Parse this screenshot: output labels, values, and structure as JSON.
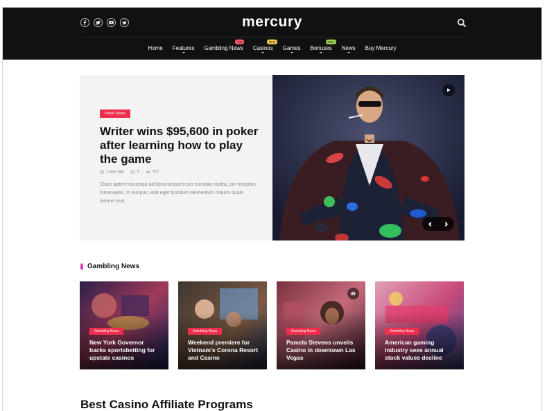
{
  "header": {
    "logo": "mercury",
    "social_icons": [
      "facebook-icon",
      "twitter-icon",
      "youtube-icon",
      "reddit-icon"
    ],
    "search_icon": "search-icon"
  },
  "nav": {
    "items": [
      {
        "label": "Home",
        "caret": false,
        "badge": ""
      },
      {
        "label": "Features",
        "caret": true,
        "badge": ""
      },
      {
        "label": "Gambling News",
        "caret": false,
        "badge": "Hot"
      },
      {
        "label": "Casinos",
        "caret": true,
        "badge": "Deal"
      },
      {
        "label": "Games",
        "caret": true,
        "badge": ""
      },
      {
        "label": "Bonuses",
        "caret": true,
        "badge": "New"
      },
      {
        "label": "News",
        "caret": true,
        "badge": ""
      },
      {
        "label": "Buy Mercury",
        "caret": false,
        "badge": ""
      }
    ]
  },
  "hero": {
    "category": "Poker News",
    "title": "Writer wins $95,600 in poker after learning how to play the game",
    "time": "1 year ago",
    "comments": "5",
    "views": "672",
    "excerpt": "Class aptent sociosqu ad litora torquent per conubia nostra, per inceptos himenaeos. In tempus, erat eget tincidunt elementum mauris quam laoreet erat."
  },
  "section": {
    "title": "Gambling News",
    "cards": [
      {
        "category": "Gambling News",
        "title": "New York Governor backs sportsbetting for upstate casinos"
      },
      {
        "category": "Gambling News",
        "title": "Weekend premiere for Vietnam's Corona Resort and Casino"
      },
      {
        "category": "Gambling News",
        "title": "Pamela Stevens unveils Casino in downtown Las Vegas"
      },
      {
        "category": "Gambling News",
        "title": "American gaming industry sees annual stock values decline"
      }
    ]
  },
  "bottom_heading": "Best Casino Affiliate Programs",
  "colors": {
    "accent": "#ef2e4d",
    "header_bg": "#111111",
    "hero_bg": "#f3f3f4"
  }
}
